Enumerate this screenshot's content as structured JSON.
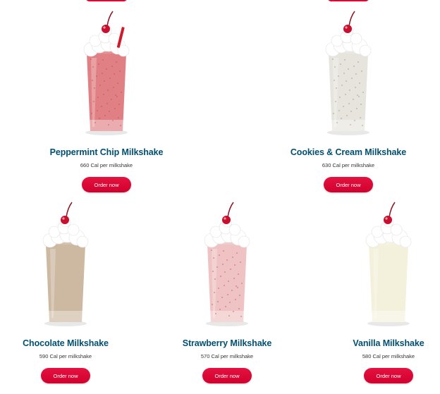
{
  "menu": {
    "items": [
      {
        "id": "peppermint",
        "name": "Peppermint Chip Milkshake",
        "calories": "660 Cal per milkshake",
        "button": "Order now",
        "shake_color": "#e08085",
        "image": "peppermint-chip-milkshake-photo"
      },
      {
        "id": "cookies",
        "name": "Cookies & Cream Milkshake",
        "calories": "630 Cal per milkshake",
        "button": "Order now",
        "shake_color": "#e6e4dc",
        "image": "cookies-cream-milkshake-photo"
      },
      {
        "id": "chocolate",
        "name": "Chocolate Milkshake",
        "calories": "590 Cal per milkshake",
        "button": "Order now",
        "shake_color": "#cdb9a2",
        "image": "chocolate-milkshake-photo"
      },
      {
        "id": "strawberry",
        "name": "Strawberry Milkshake",
        "calories": "570 Cal per milkshake",
        "button": "Order now",
        "shake_color": "#efc3c3",
        "image": "strawberry-milkshake-photo"
      },
      {
        "id": "vanilla",
        "name": "Vanilla Milkshake",
        "calories": "580 Cal per milkshake",
        "button": "Order now",
        "shake_color": "#f3f1dc",
        "image": "vanilla-milkshake-photo"
      }
    ]
  },
  "colors": {
    "title": "#004f71",
    "button": "#dd0031",
    "whipped_cream": "#ffffff",
    "cherry": "#c8102e"
  }
}
